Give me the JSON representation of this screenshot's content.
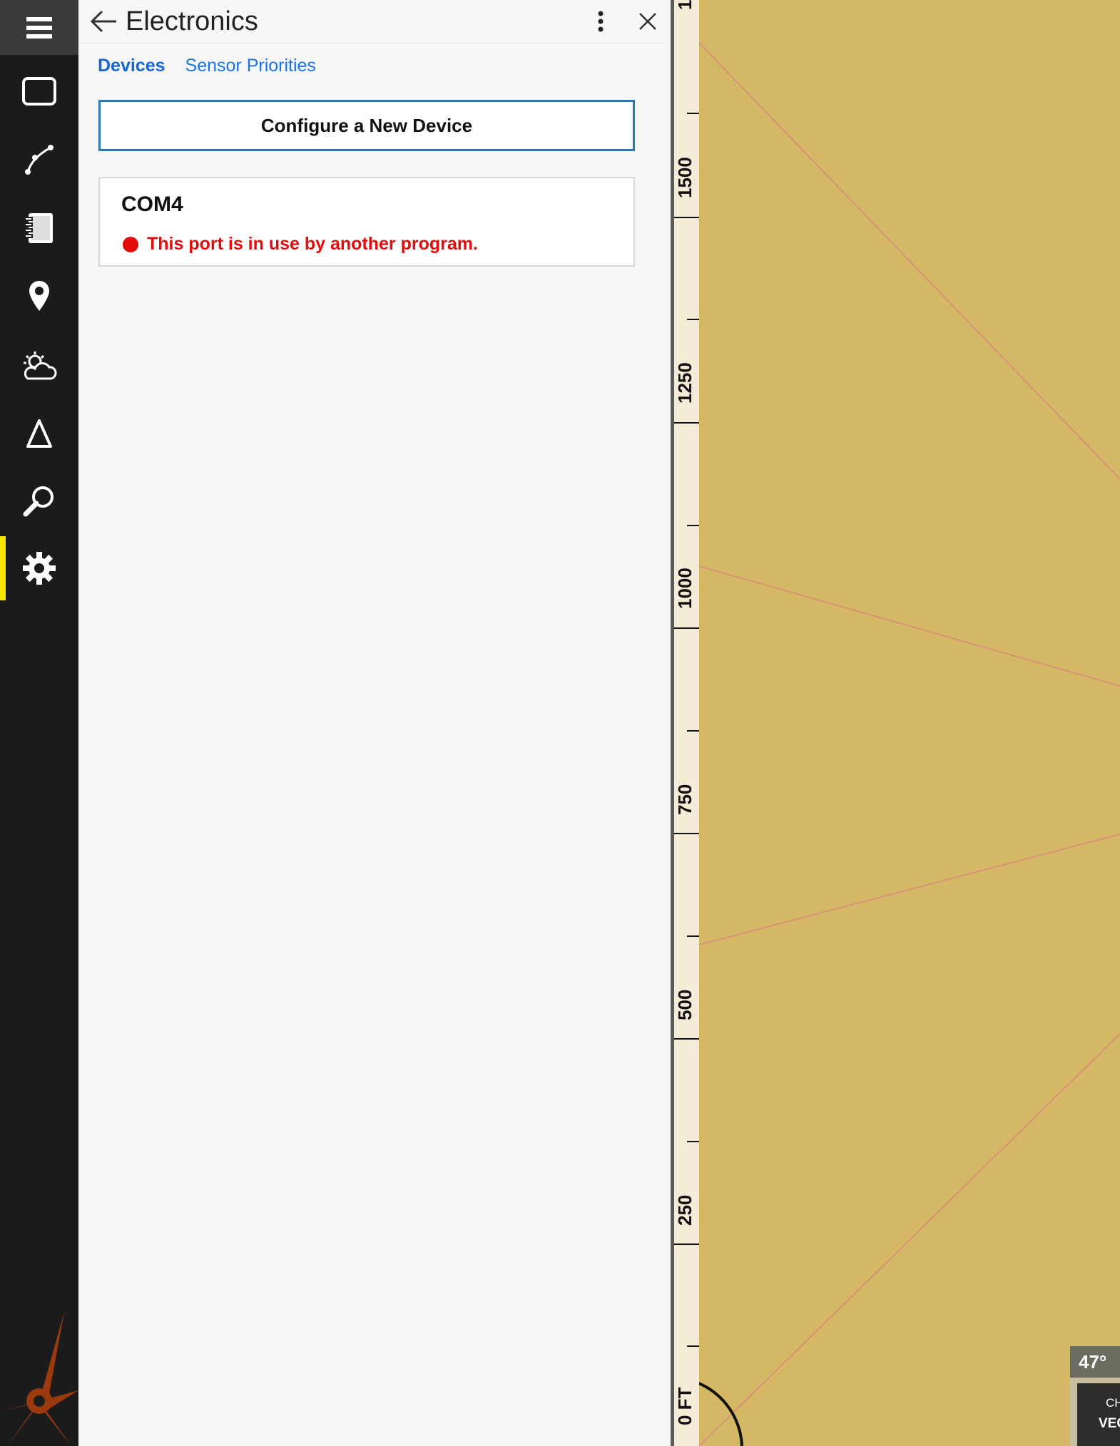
{
  "rail": {
    "items": [
      {
        "icon": "hamburger-menu-icon"
      },
      {
        "icon": "chart-window-icon"
      },
      {
        "icon": "route-icon"
      },
      {
        "icon": "notebook-icon"
      },
      {
        "icon": "map-pin-icon"
      },
      {
        "icon": "weather-icon"
      },
      {
        "icon": "tide-triangle-icon"
      },
      {
        "icon": "search-icon"
      },
      {
        "icon": "gear-icon",
        "active": true
      }
    ],
    "accent_color": "#f5e600"
  },
  "panel": {
    "title": "Electronics",
    "tabs": [
      {
        "label": "Devices",
        "active": true
      },
      {
        "label": "Sensor Priorities",
        "active": false
      }
    ],
    "configure_button": "Configure a New Device",
    "devices": [
      {
        "name": "COM4",
        "status": "This port is in use by another program.",
        "status_color": "#e20c0c"
      }
    ]
  },
  "map": {
    "ruler_labels": [
      "1",
      "1500",
      "1250",
      "1000",
      "750",
      "500",
      "250",
      "0 FT"
    ],
    "temperature": "47°",
    "chart_label_1": "CH",
    "chart_label_2": "VEC"
  }
}
